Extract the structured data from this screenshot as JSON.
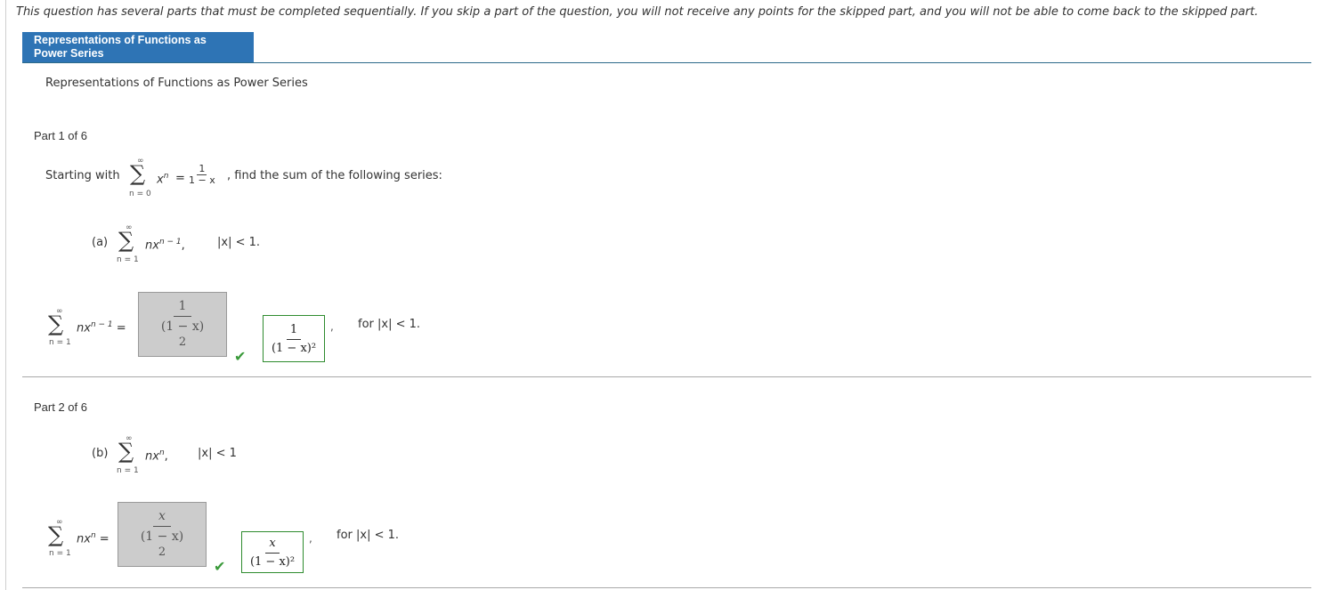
{
  "notice": "This question has several parts that must be completed sequentially. If you skip a part of the question, you will not receive any points for the skipped part, and you will not be able to come back to the skipped part.",
  "tab": {
    "line1": "Representations of Functions as",
    "line2": "Power Series"
  },
  "subtitle": "Representations of Functions as Power Series",
  "intro": {
    "prefix": "Starting with",
    "sum_upper": "∞",
    "sum_lower": "n = 0",
    "term": "x",
    "term_exp": "n",
    "equals": "=",
    "frac_num": "1",
    "frac_den": "1 − x",
    "suffix": ", find the sum of the following series:"
  },
  "part1": {
    "label": "Part 1 of 6",
    "question_label": "(a)",
    "sum_upper": "∞",
    "sum_lower": "n = 1",
    "term": "nx",
    "term_exp": "n − 1",
    "term_comma": ",",
    "condition": "|x| < 1.",
    "answer_term": "nx",
    "answer_exp": "n − 1",
    "answer_eq": "=",
    "student_num": "1",
    "student_den1": "(1 − x)",
    "student_den2": "2",
    "correct_num": "1",
    "correct_den": "(1 − x)²",
    "comma": ",",
    "for_text": "for |x| < 1."
  },
  "part2": {
    "label": "Part 2 of 6",
    "question_label": "(b)",
    "sum_upper": "∞",
    "sum_lower": "n = 1",
    "term": "nx",
    "term_exp": "n",
    "term_comma": ",",
    "condition": "|x| < 1",
    "answer_term": "nx",
    "answer_exp": "n",
    "answer_eq": "=",
    "student_num": "x",
    "student_den1": "(1 − x)",
    "student_den2": "2",
    "correct_num": "x",
    "correct_den": "(1 − x)²",
    "comma": ",",
    "for_text": "for |x| < 1."
  },
  "icons": {
    "sigma": "∑",
    "check": "✔"
  },
  "colors": {
    "tab_bg": "#2e74b5",
    "correct_border": "#2e8b2e",
    "check": "#3a9a3a",
    "answer_bg": "#cccccc"
  }
}
